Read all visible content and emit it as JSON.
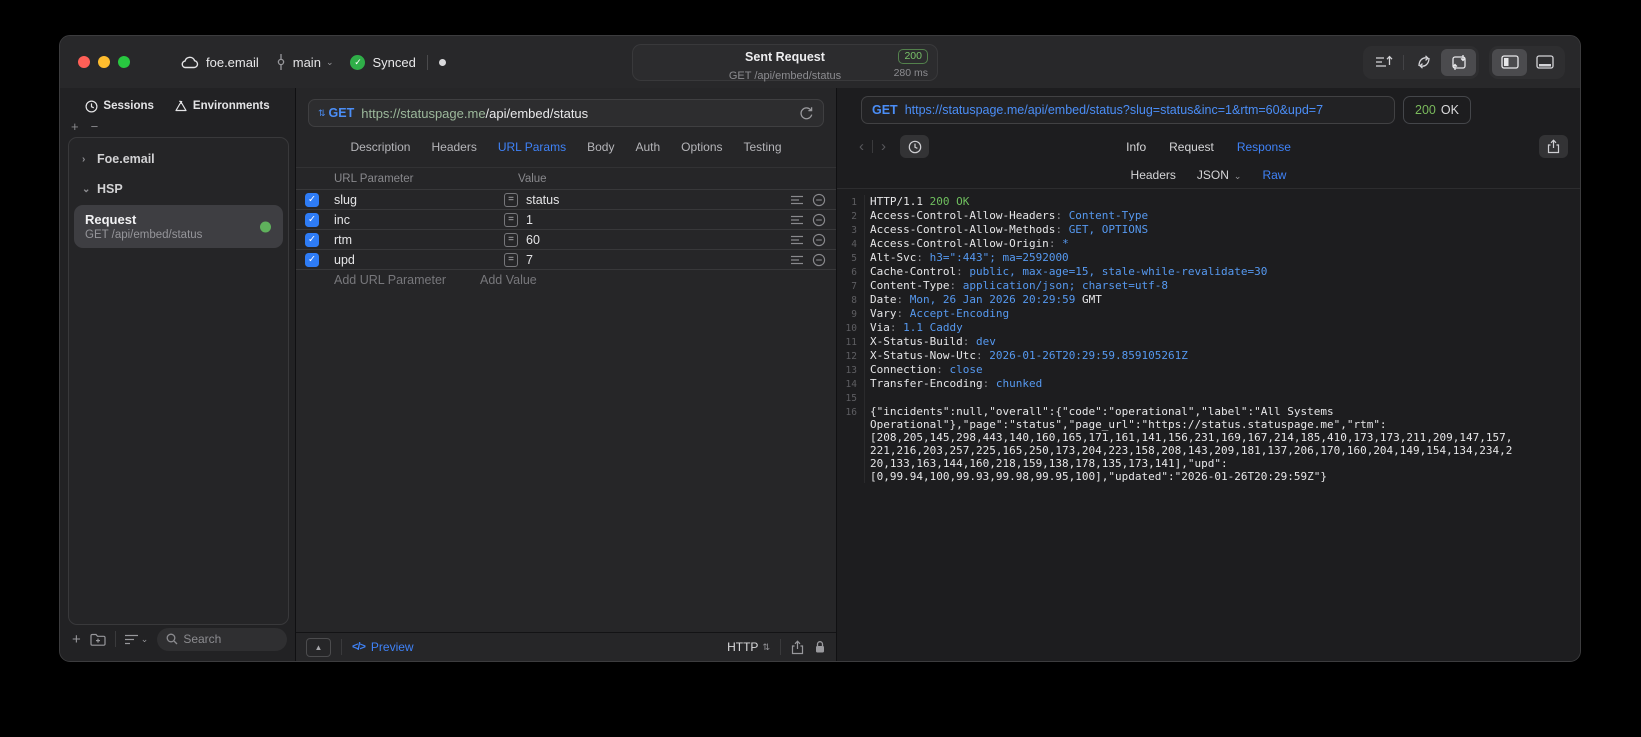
{
  "titlebar": {
    "project": "foe.email",
    "branch": "main",
    "sync_status": "Synced",
    "title": "Sent Request",
    "status_badge": "200",
    "method_path": "GET /api/embed/status",
    "duration": "280 ms"
  },
  "sidebar": {
    "tabs": [
      {
        "label": "Sessions"
      },
      {
        "label": "Environments"
      }
    ],
    "tree": [
      {
        "label": "Foe.email"
      },
      {
        "label": "HSP"
      }
    ],
    "selected_request": {
      "title": "Request",
      "subtitle": "GET /api/embed/status"
    },
    "search_placeholder": "Search"
  },
  "request_editor": {
    "method": "GET",
    "url_scheme_host": "https://statuspage.me",
    "url_path": "/api/embed/status",
    "tabs": [
      "Description",
      "Headers",
      "URL Params",
      "Body",
      "Auth",
      "Options",
      "Testing"
    ],
    "active_tab": "URL Params",
    "params_table": {
      "columns": [
        "URL Parameter",
        "Value"
      ],
      "rows": [
        {
          "enabled": true,
          "name": "slug",
          "value": "status"
        },
        {
          "enabled": true,
          "name": "inc",
          "value": "1"
        },
        {
          "enabled": true,
          "name": "rtm",
          "value": "60"
        },
        {
          "enabled": true,
          "name": "upd",
          "value": "7"
        }
      ],
      "add_row": {
        "name_placeholder": "Add URL Parameter",
        "value_placeholder": "Add Value"
      }
    },
    "footer": {
      "preview_label": "Preview",
      "code_glyph": "</>",
      "protocol": "HTTP"
    }
  },
  "response_pane": {
    "method": "GET",
    "url": "https://statuspage.me/api/embed/status?slug=status&inc=1&rtm=60&upd=7",
    "status": {
      "code": "200",
      "text": "OK"
    },
    "tabs": [
      "Info",
      "Request",
      "Response"
    ],
    "active_tab": "Response",
    "subtabs": [
      "Headers",
      "JSON",
      "Raw"
    ],
    "active_subtab": "Raw",
    "status_line": {
      "prefix": "HTTP/1.1 ",
      "status": "200 OK"
    },
    "headers": [
      {
        "key": "Access-Control-Allow-Headers",
        "value": "Content-Type"
      },
      {
        "key": "Access-Control-Allow-Methods",
        "value": "GET, OPTIONS"
      },
      {
        "key": "Access-Control-Allow-Origin",
        "value": "*"
      },
      {
        "key": "Alt-Svc",
        "value": "h3=\":443\"; ma=2592000"
      },
      {
        "key": "Cache-Control",
        "value": "public, max-age=15, stale-while-revalidate=30"
      },
      {
        "key": "Content-Type",
        "value": "application/json; charset=utf-8"
      },
      {
        "key": "Date",
        "value": "Mon, 26 Jan 2026 20:29:59",
        "suffix": " GMT"
      },
      {
        "key": "Vary",
        "value": "Accept-Encoding"
      },
      {
        "key": "Via",
        "value": "1.1 Caddy"
      },
      {
        "key": "X-Status-Build",
        "value": "dev"
      },
      {
        "key": "X-Status-Now-Utc",
        "value": "2026-01-26T20:29:59.859105261Z"
      },
      {
        "key": "Connection",
        "value": "close"
      },
      {
        "key": "Transfer-Encoding",
        "value": "chunked"
      }
    ],
    "body": "{\"incidents\":null,\"overall\":{\"code\":\"operational\",\"label\":\"All Systems Operational\"},\"page\":\"status\",\"page_url\":\"https://status.statuspage.me\",\"rtm\":[208,205,145,298,443,140,160,165,171,161,141,156,231,169,167,214,185,410,173,173,211,209,147,157,221,216,203,257,225,165,250,173,204,223,158,208,143,209,181,137,206,170,160,204,149,154,134,234,220,133,163,144,160,218,159,138,178,135,173,141],\"upd\":[0,99.94,100,99.93,99.98,99.95,100],\"updated\":\"2026-01-26T20:29:59Z\"}"
  },
  "icons": {
    "chevron_right": "›",
    "chevron_down": "⌄",
    "back": "‹",
    "forward": "›",
    "plus": "+",
    "minus": "−",
    "collapse": "▲",
    "updown": "⇅",
    "check": "✓",
    "equals": "="
  },
  "colors": {
    "accent_blue": "#3f82f7",
    "value_blue": "#5699f0",
    "status_green": "#6fbf5e",
    "badge_green": "#79c269",
    "checkbox_blue": "#2e7cf6",
    "traffic_red": "#ff5f57",
    "traffic_yellow": "#febc2e",
    "traffic_green": "#28c840"
  }
}
